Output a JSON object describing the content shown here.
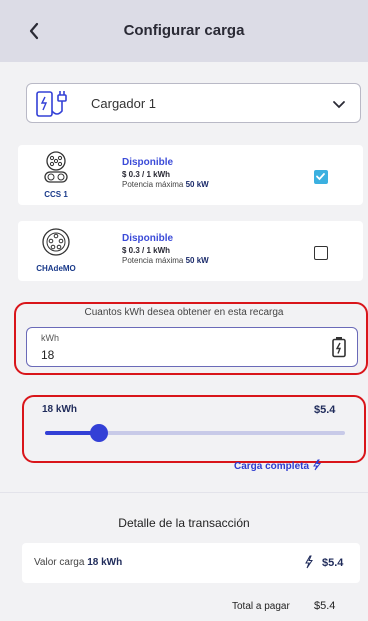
{
  "header": {
    "title": "Configurar carga",
    "back_icon": "chevron-left-icon"
  },
  "charger": {
    "selected": "Cargador 1",
    "icon": "charger-plug-icon"
  },
  "connectors": [
    {
      "name": "CCS 1",
      "status": "Disponible",
      "price": "$ 0.3 / 1 kWh",
      "power_label": "Potencia máxima",
      "power_value": "50 kW",
      "checked": true
    },
    {
      "name": "CHAdeMO",
      "status": "Disponible",
      "price": "$ 0.3 / 1 kWh",
      "power_label": "Potencia máxima",
      "power_value": "50 kW",
      "checked": false
    }
  ],
  "kwh_input": {
    "question": "Cuantos kWh desea obtener en esta recarga",
    "label": "kWh",
    "value": "18"
  },
  "slider": {
    "kwh_label": "18 kWh",
    "amount": "$5.4",
    "fraction": 0.18,
    "full_charge_label": "Carga completa"
  },
  "detail": {
    "title": "Detalle de la transacción",
    "row_label": "Valor carga",
    "row_kwh": "18 kWh",
    "row_amount": "$5.4",
    "total_label": "Total a pagar",
    "total_amount": "$5.4"
  },
  "colors": {
    "accent": "#3340d6",
    "check": "#3bb0e0",
    "highlight": "#d9151a"
  }
}
